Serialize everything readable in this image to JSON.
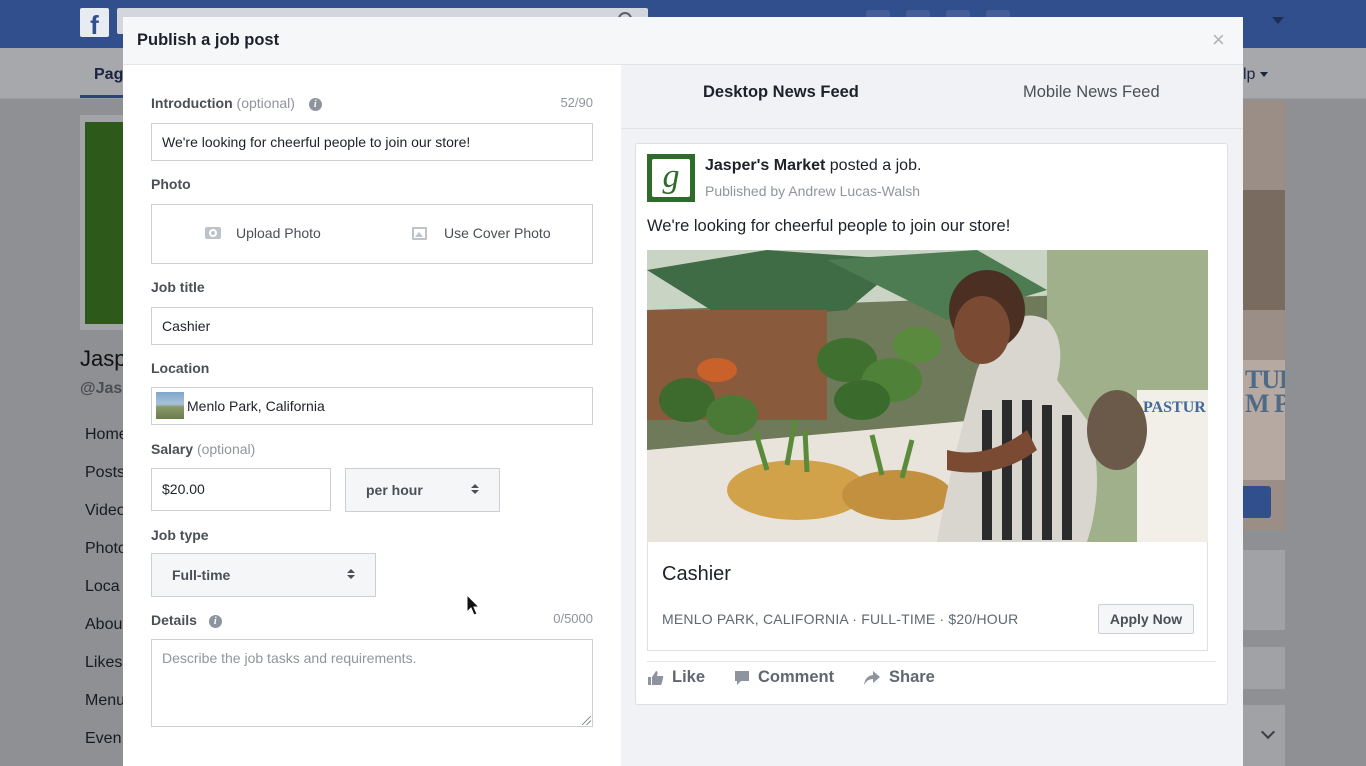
{
  "background": {
    "page_tab_left": "Pag",
    "page_tab_right": "lp",
    "page_name": "Jasp",
    "page_handle": "@Jas",
    "sidenav": [
      "Home",
      "Posts",
      "Video",
      "Photo",
      "Loca",
      "Abou",
      "Likes",
      "Menu",
      "Even"
    ],
    "cover_text": "TUR\nM P"
  },
  "modal": {
    "title": "Publish a job post",
    "form": {
      "intro_label": "Introduction",
      "intro_optional": "(optional)",
      "intro_counter": "52/90",
      "intro_value": "We're looking for cheerful people to join our store!",
      "photo_label": "Photo",
      "upload_photo": "Upload Photo",
      "use_cover_photo": "Use Cover Photo",
      "job_title_label": "Job title",
      "job_title_value": "Cashier",
      "location_label": "Location",
      "location_value": "Menlo Park, California",
      "salary_label": "Salary",
      "salary_optional": "(optional)",
      "salary_value": "$20.00",
      "salary_period": "per hour",
      "job_type_label": "Job type",
      "job_type_value": "Full-time",
      "details_label": "Details",
      "details_counter": "0/5000",
      "details_placeholder": "Describe the job tasks and requirements."
    },
    "preview": {
      "tabs": [
        "Desktop News Feed",
        "Mobile News Feed"
      ],
      "page_name": "Jasper's Market",
      "posted_text": "posted a job.",
      "published_by": "Published by Andrew Lucas-Walsh",
      "post_text": "We're looking for cheerful people to join our store!",
      "job_title": "Cashier",
      "job_meta": "MENLO PARK, CALIFORNIA · FULL-TIME · $20/HOUR",
      "apply_label": "Apply Now",
      "actions": {
        "like": "Like",
        "comment": "Comment",
        "share": "Share"
      }
    }
  },
  "colors": {
    "fb_blue": "#314f8c",
    "brand_green": "#2f6b2a",
    "text_dark": "#1d2129",
    "text_muted": "#90949c"
  }
}
